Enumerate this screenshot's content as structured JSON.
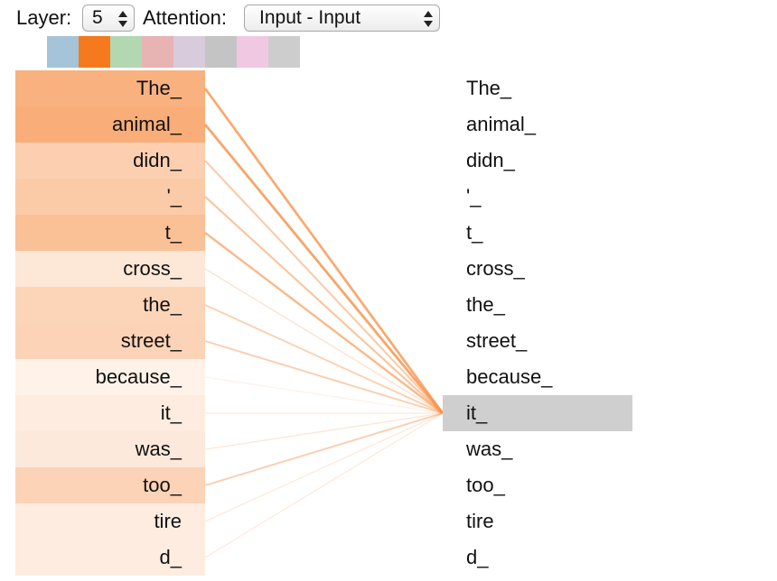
{
  "controls": {
    "layer_label": "Layer:",
    "layer_value": "5",
    "attention_label": "Attention:",
    "attention_value": "Input - Input"
  },
  "head_swatches": [
    {
      "color": "#a6c4d9"
    },
    {
      "color": "#f57a1e"
    },
    {
      "color": "#b3d7b1"
    },
    {
      "color": "#e7b3b3"
    },
    {
      "color": "#d8cbdb"
    },
    {
      "color": "#c4c4c4"
    },
    {
      "color": "#f0c8e2"
    },
    {
      "color": "#cdcdcd"
    }
  ],
  "attention_color": "#f7944d",
  "selected_color": "#cfcfcf",
  "selected_index": 9,
  "tokens": [
    "The_",
    "animal_",
    "didn_",
    "'_",
    "t_",
    "cross_",
    "the_",
    "street_",
    "because_",
    "it_",
    "was_",
    "too_",
    "tire",
    "d_"
  ],
  "weights": [
    0.78,
    0.82,
    0.45,
    0.5,
    0.62,
    0.18,
    0.38,
    0.4,
    0.05,
    0.12,
    0.15,
    0.4,
    0.12,
    0.12
  ]
}
